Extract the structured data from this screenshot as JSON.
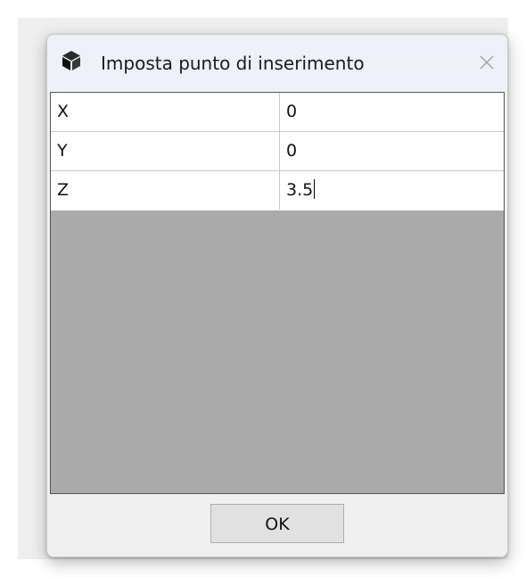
{
  "window": {
    "title": "Imposta punto di inserimento",
    "icon": "cube-icon",
    "close_icon": "close-icon"
  },
  "grid": {
    "rows": [
      {
        "name": "X",
        "value": "0"
      },
      {
        "name": "Y",
        "value": "0"
      },
      {
        "name": "Z",
        "value": "3.5"
      }
    ],
    "empty_area_color": "#ababab"
  },
  "footer": {
    "ok_label": "OK"
  }
}
